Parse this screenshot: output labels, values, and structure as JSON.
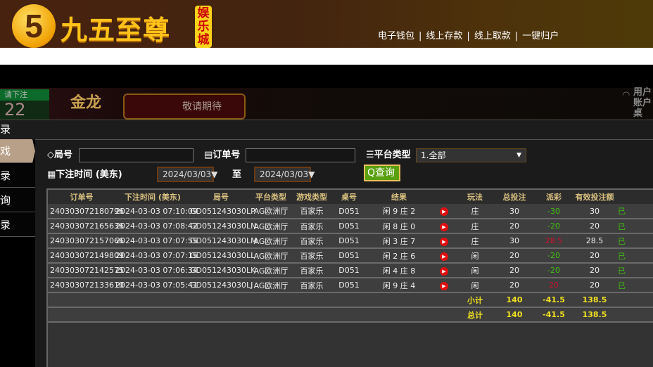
{
  "header": {
    "logo_mark": "5",
    "logo_text": "九五至尊",
    "logo_tag": "娱乐城",
    "links": [
      "电子钱包",
      "线上存款",
      "线上取款",
      "一键归户"
    ]
  },
  "game": {
    "bet_label": "请下注",
    "countdown": "22",
    "banner_logo": "金龙",
    "banner_text": "敬请期待",
    "right_labels": [
      "用户",
      "账户",
      "桌"
    ]
  },
  "dialog": {
    "title": "录"
  },
  "sidebar": {
    "items": [
      {
        "label": "戏",
        "active": true
      },
      {
        "label": "录"
      },
      {
        "label": "询"
      },
      {
        "label": "录"
      }
    ]
  },
  "filters": {
    "round_label": "局号",
    "round_value": "",
    "order_label": "订单号",
    "order_value": "",
    "platform_label": "平台类型",
    "platform_value": "1.全部",
    "time_label": "下注时间 (美东)",
    "date_from": "2024/03/03",
    "to_label": "至",
    "date_to": "2024/03/03",
    "query_button": "查询"
  },
  "table": {
    "headers": [
      "订单号",
      "下注时间 (美东)",
      "局号",
      "平台类型",
      "游戏类型",
      "桌号",
      "结果",
      "",
      "玩法",
      "总投注",
      "派彩",
      "有效投注额",
      ""
    ],
    "rows": [
      {
        "order": "240303072180796",
        "time": "2024-03-03 07:10:09",
        "round": "GD051243030LP",
        "platform": "AG欧洲厅",
        "game": "百家乐",
        "table": "D051",
        "result": "闲 9 庄 2",
        "bet": "庄",
        "total": "30",
        "payout": "-30",
        "payout_color": "#40c010",
        "valid": "30",
        "status": "已"
      },
      {
        "order": "240303072165636",
        "time": "2024-03-03 07:08:42",
        "round": "GD051243030LN",
        "platform": "AG欧洲厅",
        "game": "百家乐",
        "table": "D051",
        "result": "闲 8 庄 0",
        "bet": "庄",
        "total": "20",
        "payout": "-20",
        "payout_color": "#40c010",
        "valid": "20",
        "status": "已"
      },
      {
        "order": "240303072157066",
        "time": "2024-03-03 07:07:55",
        "round": "GD051243030LM",
        "platform": "AG欧洲厅",
        "game": "百家乐",
        "table": "D051",
        "result": "闲 3 庄 7",
        "bet": "庄",
        "total": "30",
        "payout": "28.5",
        "payout_color": "#d01030",
        "valid": "28.5",
        "status": "已"
      },
      {
        "order": "240303072149809",
        "time": "2024-03-03 07:07:15",
        "round": "GD051243030LL",
        "platform": "AG欧洲厅",
        "game": "百家乐",
        "table": "D051",
        "result": "闲 2 庄 6",
        "bet": "闲",
        "total": "20",
        "payout": "-20",
        "payout_color": "#40c010",
        "valid": "20",
        "status": "已"
      },
      {
        "order": "240303072142575",
        "time": "2024-03-03 07:06:34",
        "round": "GD051243030LK",
        "platform": "AG欧洲厅",
        "game": "百家乐",
        "table": "D051",
        "result": "闲 4 庄 8",
        "bet": "闲",
        "total": "20",
        "payout": "-20",
        "payout_color": "#40c010",
        "valid": "20",
        "status": "已"
      },
      {
        "order": "240303072133610",
        "time": "2024-03-03 07:05:41",
        "round": "GD051243030LJ",
        "platform": "AG欧洲厅",
        "game": "百家乐",
        "table": "D051",
        "result": "闲 9 庄 4",
        "bet": "闲",
        "total": "20",
        "payout": "20",
        "payout_color": "#d01030",
        "valid": "20",
        "status": "已"
      }
    ],
    "subtotal": {
      "label": "小计",
      "total": "140",
      "payout": "-41.5",
      "valid": "138.5"
    },
    "grand_total": {
      "label": "总计",
      "total": "140",
      "payout": "-41.5",
      "valid": "138.5"
    }
  }
}
